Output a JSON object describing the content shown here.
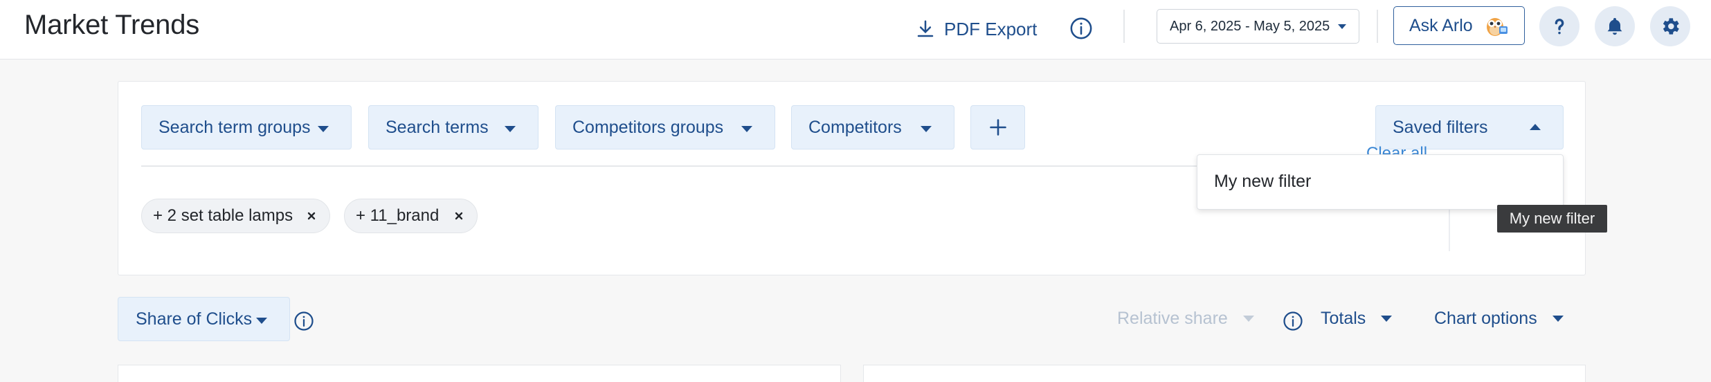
{
  "header": {
    "title": "Market Trends",
    "pdf_export_label": "PDF Export",
    "date_range": "Apr 6, 2025 - May 5, 2025",
    "ask_arlo_label": "Ask Arlo"
  },
  "filters": {
    "buttons": [
      {
        "label": "Search term groups"
      },
      {
        "label": "Search terms"
      },
      {
        "label": "Competitors groups"
      },
      {
        "label": "Competitors"
      }
    ],
    "saved_filters_label": "Saved filters",
    "chips": [
      {
        "label": "+ 2 set table lamps"
      },
      {
        "label": "+ 11_brand"
      }
    ],
    "clear_all_label": "Clear all",
    "dropdown_items": [
      "My new filter"
    ],
    "tooltip": "My new filter"
  },
  "controls": {
    "metric_label": "Share of Clicks",
    "relative_share_label": "Relative share",
    "totals_label": "Totals",
    "chart_options_label": "Chart options"
  },
  "colors": {
    "accent": "#1f4e8c",
    "button_bg": "#e8f1fb",
    "link": "#3b87d4"
  }
}
